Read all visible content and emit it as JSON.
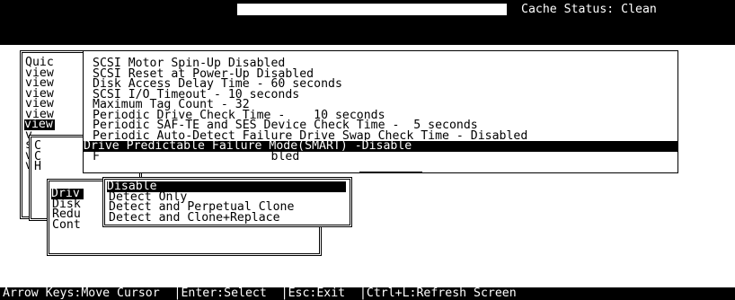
{
  "header": {
    "cache_status": "Cache Status: Clean"
  },
  "main_menu": {
    "items": [
      {
        "label": "Quic"
      },
      {
        "label": "view"
      },
      {
        "label": "view"
      },
      {
        "label": "view"
      },
      {
        "label": "view"
      },
      {
        "label": "view"
      },
      {
        "label": "view",
        "highlighted": true
      },
      {
        "label": "v"
      },
      {
        "label": "s"
      },
      {
        "label": "v"
      },
      {
        "label": "v"
      }
    ]
  },
  "sub_menu": {
    "items": [
      {
        "label": "C"
      },
      {
        "label": "C"
      },
      {
        "label": "H"
      }
    ]
  },
  "sub_sub_menu": {
    "items": [
      {
        "label": "Driv",
        "highlighted": true
      },
      {
        "label": "Disk"
      },
      {
        "label": "Redu"
      },
      {
        "label": "Cont"
      }
    ]
  },
  "settings_list": {
    "items": [
      {
        "label": "SCSI Motor Spin-Up Disabled"
      },
      {
        "label": "SCSI Reset at Power-Up Disabled"
      },
      {
        "label": "Disk Access Delay Time - 60 seconds"
      },
      {
        "label": "SCSI I/O Timeout - 10 seconds"
      },
      {
        "label": "Maximum Tag Count - 32"
      },
      {
        "label": "Periodic Drive Check Time -    10 seconds"
      },
      {
        "label": "Periodic SAF-TE and SES Device Check Time -  5 seconds"
      },
      {
        "label": "Periodic Auto-Detect Failure Drive Swap Check Time - Disabled"
      },
      {
        "label": "Drive Predictable Failure Mode(SMART) -Disable",
        "highlighted": true
      },
      {
        "label": "F"
      }
    ],
    "partial_behind": "bled"
  },
  "smart_options": {
    "options": [
      {
        "label": "Disable",
        "selected": true
      },
      {
        "label": "Detect Only"
      },
      {
        "label": "Detect and Perpetual Clone"
      },
      {
        "label": "Detect and Clone+Replace"
      }
    ]
  },
  "status_bar": {
    "text": "Arrow Keys:Move Cursor  |Enter:Select  |Esc:Exit  |Ctrl+L:Refresh Screen"
  }
}
